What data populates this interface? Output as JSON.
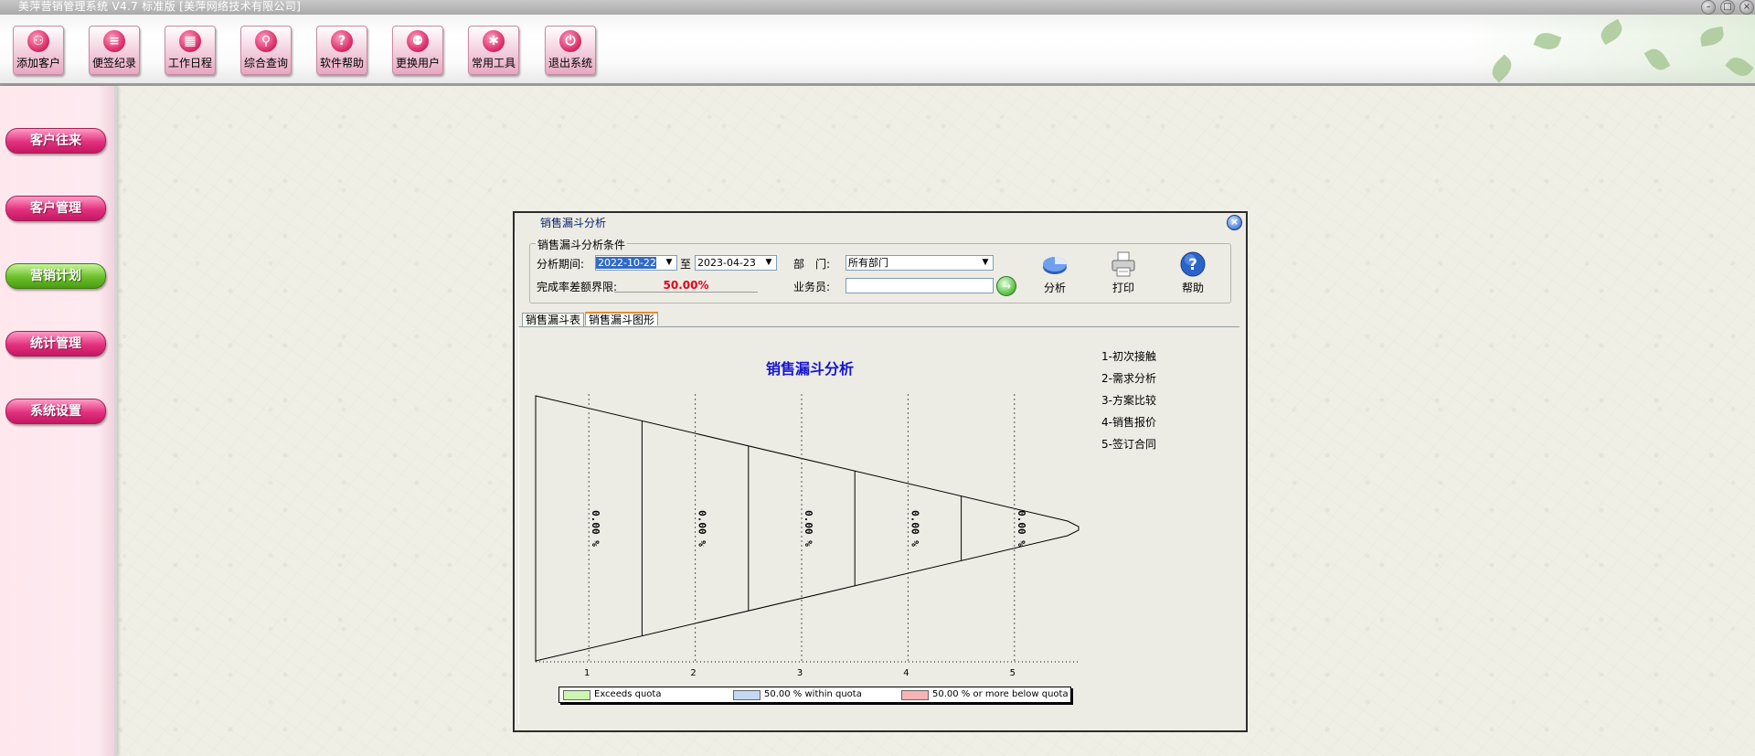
{
  "window": {
    "title": "美萍营销管理系统 V4.7 标准版 [美萍网络技术有限公司]",
    "controls": {
      "minimize": "–",
      "maximize": "□",
      "close": "×"
    }
  },
  "toolbar": {
    "buttons": [
      {
        "label": "添加客户",
        "icon": "person-add-icon",
        "glyph": "⚇"
      },
      {
        "label": "便签纪录",
        "icon": "notepad-icon",
        "glyph": "≡"
      },
      {
        "label": "工作日程",
        "icon": "calendar-icon",
        "glyph": "▦"
      },
      {
        "label": "综合查询",
        "icon": "search-icon",
        "glyph": "⚲"
      },
      {
        "label": "软件帮助",
        "icon": "help-icon",
        "glyph": "?"
      },
      {
        "label": "更换用户",
        "icon": "switch-user-icon",
        "glyph": "⚉"
      },
      {
        "label": "常用工具",
        "icon": "gear-icon",
        "glyph": "✱"
      },
      {
        "label": "退出系统",
        "icon": "power-icon",
        "glyph": "⏻"
      }
    ]
  },
  "sidebar": {
    "items": [
      {
        "label": "客户往来",
        "active": false
      },
      {
        "label": "客户管理",
        "active": false
      },
      {
        "label": "营销计划",
        "active": true
      },
      {
        "label": "统计管理",
        "active": false
      },
      {
        "label": "系统设置",
        "active": false
      }
    ]
  },
  "dialog": {
    "title": "销售漏斗分析",
    "close_glyph": "×",
    "conditions": {
      "legend": "销售漏斗分析条件",
      "period_label": "分析期间:",
      "period_from": "2022-10-22",
      "period_to_label": "至",
      "period_to": "2023-04-23",
      "dept_label": "部　门:",
      "dept_value": "所有部门",
      "rate_label": "完成率差额界限:",
      "rate_value": "50.00%",
      "sales_label": "业务员:",
      "sales_value": "",
      "go_glyph": "→"
    },
    "actions": [
      {
        "label": "分析",
        "icon": "pie-chart-icon"
      },
      {
        "label": "打印",
        "icon": "printer-icon"
      },
      {
        "label": "帮助",
        "icon": "help-icon"
      }
    ],
    "tabs": [
      {
        "label": "销售漏斗表",
        "active": false
      },
      {
        "label": "销售漏斗图形",
        "active": true
      }
    ]
  },
  "chart_data": {
    "type": "funnel",
    "title": "销售漏斗分析",
    "categories": [
      "1",
      "2",
      "3",
      "4",
      "5"
    ],
    "values": [
      "0.00 %",
      "0.00 %",
      "0.00 %",
      "0.00 %",
      "0.00 %"
    ],
    "stage_names": [
      "1-初次接触",
      "2-需求分析",
      "3-方案比较",
      "4-销售报价",
      "5-签订合同"
    ],
    "quota_legend": [
      {
        "label": "Exceeds quota",
        "color": "#ccf5b0"
      },
      {
        "label": "50.00 % within quota",
        "color": "#c4d8f4"
      },
      {
        "label": "50.00 % or more below quota",
        "color": "#f8b4b4"
      }
    ],
    "grid": true,
    "gridline_style": "dotted"
  }
}
